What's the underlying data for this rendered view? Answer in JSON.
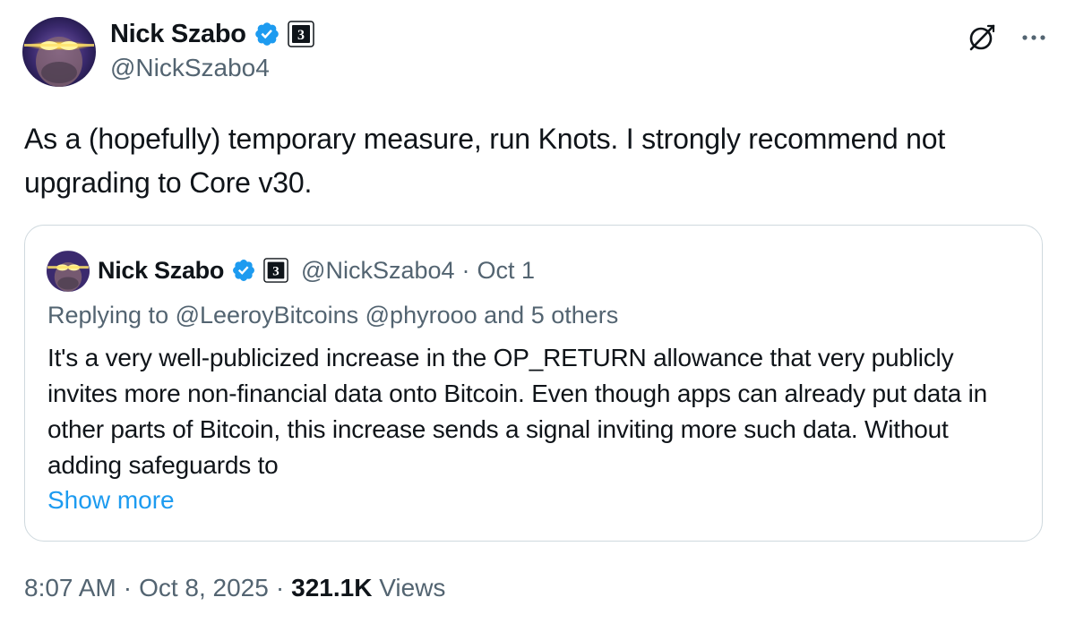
{
  "author": {
    "name": "Nick Szabo",
    "handle": "@NickSzabo4",
    "affiliation_badge_text": "3",
    "verified_color": "#1d9bf0"
  },
  "icons": {
    "verified": "verified-badge-icon",
    "affiliation": "affiliation-badge-icon",
    "grok": "grok-icon",
    "more": "more-options-icon"
  },
  "tweet": {
    "text": "As a (hopefully) temporary measure, run Knots. I strongly recommend not upgrading to Core v30."
  },
  "quote": {
    "name": "Nick Szabo",
    "handle": "@NickSzabo4",
    "separator": "·",
    "date": "Oct 1",
    "replying_prefix": "Replying to",
    "replying_to_1": "@LeeroyBitcoins",
    "replying_to_2": "@phyrooo",
    "replying_suffix": "and 5 others",
    "body": "It's a very well-publicized increase in the OP_RETURN allowance that very publicly invites more non-financial data onto Bitcoin.  Even though apps can already put data in other parts of Bitcoin, this increase sends a signal inviting more such data.  Without adding safeguards to",
    "show_more": "Show more"
  },
  "meta": {
    "time": "8:07 AM",
    "separator": "·",
    "date": "Oct 8, 2025",
    "views_count": "321.1K",
    "views_label": "Views"
  },
  "colors": {
    "text_primary": "#0f1419",
    "text_secondary": "#536471",
    "link": "#1d9bf0",
    "border": "#cfd9de"
  }
}
